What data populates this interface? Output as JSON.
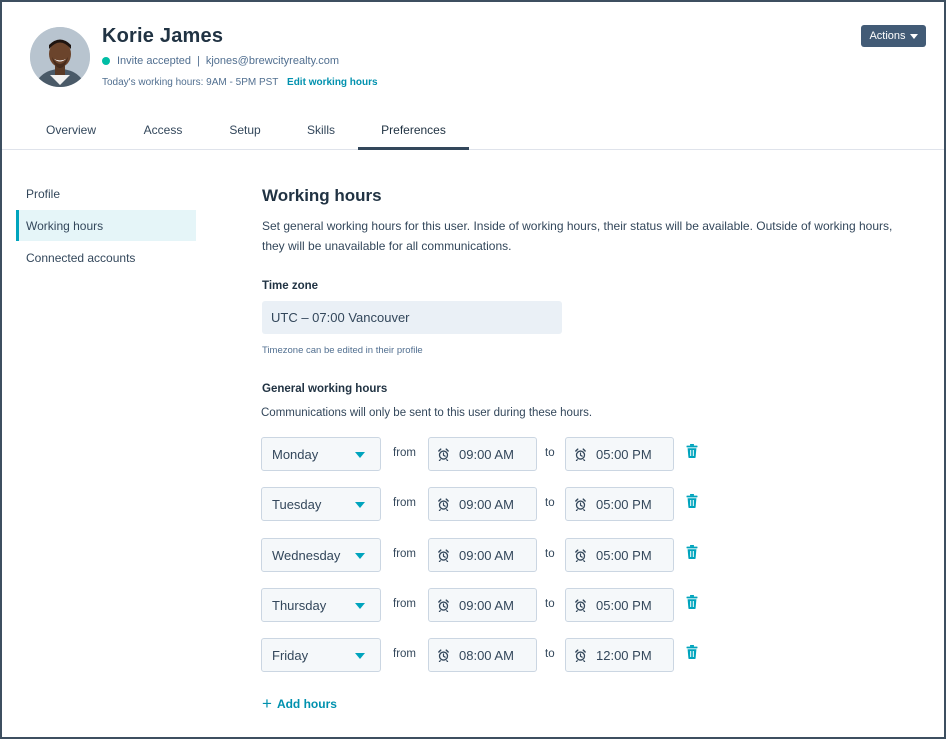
{
  "user": {
    "name": "Korie James",
    "status": "Invite accepted",
    "separator": "|",
    "email": "kjones@brewcityrealty.com",
    "todays_hours": "Today's working hours: 9AM - 5PM PST",
    "edit_link": "Edit working hours",
    "status_color": "#00bda5"
  },
  "header": {
    "actions_label": "Actions"
  },
  "tabs": [
    {
      "label": "Overview",
      "active": false
    },
    {
      "label": "Access",
      "active": false
    },
    {
      "label": "Setup",
      "active": false
    },
    {
      "label": "Skills",
      "active": false
    },
    {
      "label": "Preferences",
      "active": true
    }
  ],
  "sidebar": {
    "items": [
      {
        "label": "Profile",
        "active": false
      },
      {
        "label": "Working hours",
        "active": true
      },
      {
        "label": "Connected accounts",
        "active": false
      }
    ]
  },
  "main": {
    "title": "Working hours",
    "description": "Set general working hours for this user. Inside of working hours, their status will be available. Outside of working hours, they will be unavailable for all communications.",
    "timezone_label": "Time zone",
    "timezone_value": "UTC – 07:00 Vancouver",
    "timezone_help": "Timezone can be edited in their profile",
    "general_label": "General working hours",
    "general_sub": "Communications will only be sent to this user during these hours.",
    "from_word": "from",
    "to_word": "to",
    "rows": [
      {
        "day": "Monday",
        "from": "09:00 AM",
        "to": "05:00 PM"
      },
      {
        "day": "Tuesday",
        "from": "09:00 AM",
        "to": "05:00 PM"
      },
      {
        "day": "Wednesday",
        "from": "09:00 AM",
        "to": "05:00 PM"
      },
      {
        "day": "Thursday",
        "from": "09:00 AM",
        "to": "05:00 PM"
      },
      {
        "day": "Friday",
        "from": "08:00 AM",
        "to": "12:00 PM"
      }
    ],
    "add_hours": "Add hours"
  },
  "colors": {
    "accent": "#00a4bd",
    "link": "#0091ae",
    "button": "#425b76",
    "text": "#33475b"
  },
  "icons": {
    "avatar": "user-photo",
    "status": "status-dot",
    "actions": "caret-down-icon",
    "day_select": "triangle-down-icon",
    "time": "alarm-clock-icon",
    "remove": "trash-icon",
    "add": "plus-icon"
  }
}
